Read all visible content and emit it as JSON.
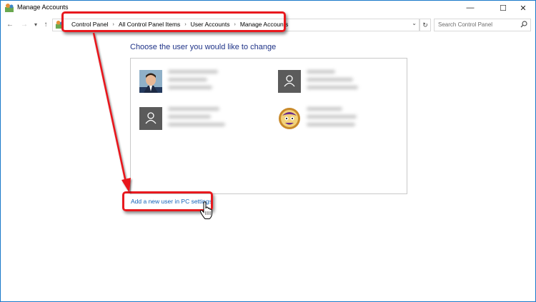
{
  "window": {
    "title": "Manage Accounts",
    "accent": "#1979ca"
  },
  "caption_buttons": {
    "minimize": "—",
    "maximize": "☐",
    "close": "✕"
  },
  "nav": {
    "back": "←",
    "forward": "→",
    "recent": "▾",
    "up": "↑"
  },
  "breadcrumb": [
    "Control Panel",
    "All Control Panel Items",
    "User Accounts",
    "Manage Accounts"
  ],
  "breadcrumb_separator": "›",
  "address_dropdown": "⌄",
  "refresh": "↻",
  "search": {
    "placeholder": "Search Control Panel"
  },
  "main": {
    "heading": "Choose the user you would like to change",
    "add_user_link": "Add a new user in PC settings"
  },
  "accounts": [
    {
      "avatar": "photo-avatar"
    },
    {
      "avatar": "generic-user-icon"
    },
    {
      "avatar": "generic-user-icon"
    },
    {
      "avatar": "cartoon-avatar"
    }
  ],
  "highlight_color": "#e8191e",
  "link_color": "#1463b8",
  "heading_color": "#1e3287"
}
